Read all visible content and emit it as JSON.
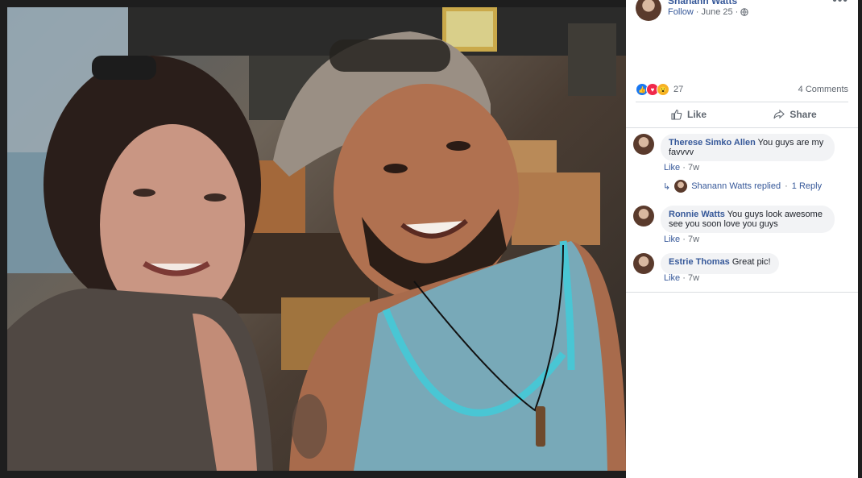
{
  "post": {
    "author": "Shanann Watts",
    "follow_label": "Follow",
    "date": "June 25",
    "privacy_icon": "globe-icon",
    "more_icon": "more-icon",
    "reaction_count": "27",
    "comments_count": "4 Comments"
  },
  "actions": {
    "like_label": "Like",
    "share_label": "Share"
  },
  "comments": [
    {
      "author": "Therese Simko Allen",
      "text": "You guys are my favvvv",
      "like_label": "Like",
      "age": "7w"
    },
    {
      "author": "Ronnie Watts",
      "text": "You guys look awesome see you soon love you guys",
      "like_label": "Like",
      "age": "7w"
    },
    {
      "author": "Estrie Thomas",
      "text": "Great pic!",
      "like_label": "Like",
      "age": "7w"
    }
  ],
  "reply": {
    "text": "Shanann Watts replied",
    "link": "1 Reply"
  },
  "colors": {
    "link": "#365899",
    "panel_bg": "#ffffff",
    "bubble_bg": "#f2f3f5"
  }
}
